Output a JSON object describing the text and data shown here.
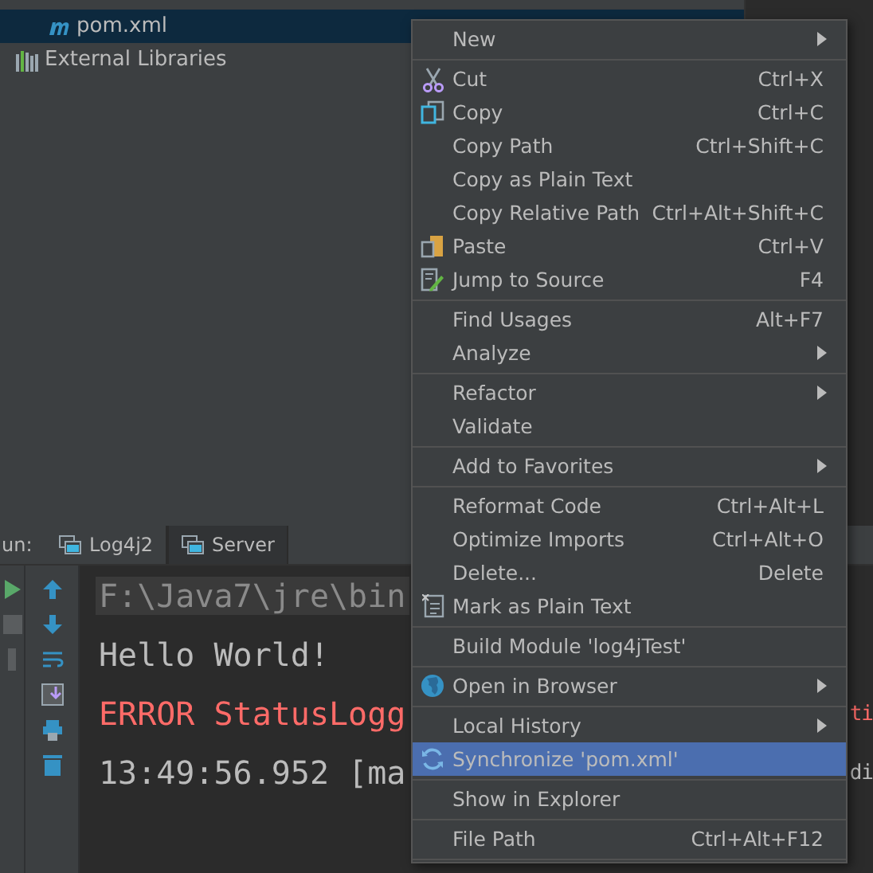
{
  "project_tree": {
    "items": [
      {
        "label": "pom.xml",
        "selected": true
      },
      {
        "label": "External Libraries",
        "selected": false
      }
    ]
  },
  "run_panel": {
    "label": "un:",
    "tabs": [
      {
        "label": "Log4j2",
        "selected": false
      },
      {
        "label": "Server",
        "selected": true
      }
    ],
    "console": [
      {
        "kind": "command",
        "text": "F:\\Java7\\jre\\bin"
      },
      {
        "kind": "plain",
        "text": "Hello World!"
      },
      {
        "kind": "error",
        "text": "ERROR StatusLogg",
        "tail": "ti"
      },
      {
        "kind": "plain",
        "text": "13:49:56.952 [ma",
        "tail": "di"
      }
    ]
  },
  "context_menu": {
    "items": [
      {
        "kind": "item",
        "label": "New",
        "submenu": true,
        "selected": false
      },
      {
        "kind": "separator"
      },
      {
        "kind": "item",
        "label": "Cut",
        "shortcut": "Ctrl+X",
        "submenu": false,
        "selected": false
      },
      {
        "kind": "item",
        "label": "Copy",
        "shortcut": "Ctrl+C",
        "submenu": false,
        "selected": false
      },
      {
        "kind": "item",
        "label": "Copy Path",
        "shortcut": "Ctrl+Shift+C",
        "submenu": false,
        "selected": false
      },
      {
        "kind": "item",
        "label": "Copy as Plain Text",
        "submenu": false,
        "selected": false
      },
      {
        "kind": "item",
        "label": "Copy Relative Path",
        "shortcut": "Ctrl+Alt+Shift+C",
        "submenu": false,
        "selected": false
      },
      {
        "kind": "item",
        "label": "Paste",
        "shortcut": "Ctrl+V",
        "submenu": false,
        "selected": false
      },
      {
        "kind": "item",
        "label": "Jump to Source",
        "shortcut": "F4",
        "submenu": false,
        "selected": false
      },
      {
        "kind": "separator"
      },
      {
        "kind": "item",
        "label": "Find Usages",
        "shortcut": "Alt+F7",
        "submenu": false,
        "selected": false
      },
      {
        "kind": "item",
        "label": "Analyze",
        "submenu": true,
        "selected": false
      },
      {
        "kind": "separator"
      },
      {
        "kind": "item",
        "label": "Refactor",
        "submenu": true,
        "selected": false
      },
      {
        "kind": "item",
        "label": "Validate",
        "submenu": false,
        "selected": false
      },
      {
        "kind": "separator"
      },
      {
        "kind": "item",
        "label": "Add to Favorites",
        "submenu": true,
        "selected": false
      },
      {
        "kind": "separator"
      },
      {
        "kind": "item",
        "label": "Reformat Code",
        "shortcut": "Ctrl+Alt+L",
        "submenu": false,
        "selected": false
      },
      {
        "kind": "item",
        "label": "Optimize Imports",
        "shortcut": "Ctrl+Alt+O",
        "submenu": false,
        "selected": false
      },
      {
        "kind": "item",
        "label": "Delete...",
        "shortcut": "Delete",
        "submenu": false,
        "selected": false
      },
      {
        "kind": "item",
        "label": "Mark as Plain Text",
        "submenu": false,
        "selected": false
      },
      {
        "kind": "separator"
      },
      {
        "kind": "item",
        "label": "Build Module 'log4jTest'",
        "submenu": false,
        "selected": false
      },
      {
        "kind": "separator"
      },
      {
        "kind": "item",
        "label": "Open in Browser",
        "submenu": true,
        "selected": false
      },
      {
        "kind": "separator"
      },
      {
        "kind": "item",
        "label": "Local History",
        "submenu": true,
        "selected": false
      },
      {
        "kind": "item",
        "label": "Synchronize 'pom.xml'",
        "submenu": false,
        "selected": true
      },
      {
        "kind": "separator"
      },
      {
        "kind": "item",
        "label": "Show in Explorer",
        "submenu": false,
        "selected": false
      },
      {
        "kind": "separator"
      },
      {
        "kind": "item",
        "label": "File Path",
        "shortcut": "Ctrl+Alt+F12",
        "submenu": false,
        "selected": false
      },
      {
        "kind": "separator"
      }
    ]
  }
}
